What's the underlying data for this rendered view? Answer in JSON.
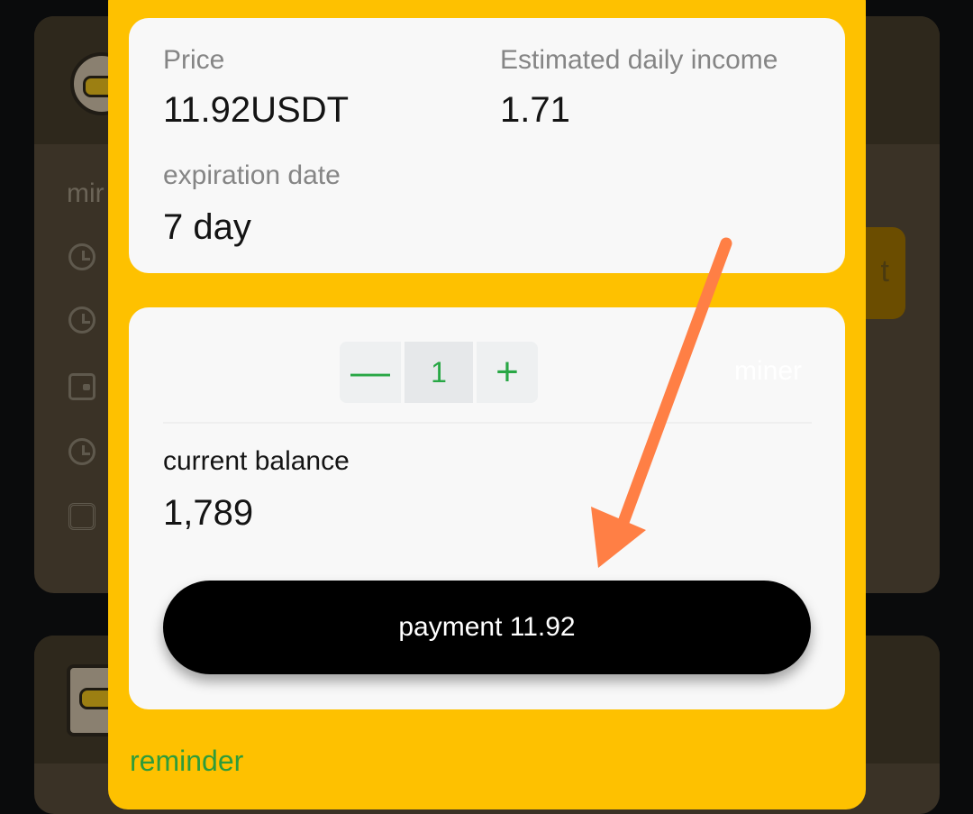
{
  "background": {
    "partial_label": "mir",
    "partial_button": "t"
  },
  "product": {
    "price_label": "Price",
    "price_value": "11.92USDT",
    "income_label": "Estimated daily income",
    "income_value": "1.71",
    "expiration_label": "expiration date",
    "expiration_value": "7 day"
  },
  "purchase": {
    "minus_symbol": "—",
    "quantity": "1",
    "plus_symbol": "+",
    "unit": "miner",
    "balance_label": "current balance",
    "balance_value": "1,789",
    "pay_button_label": "payment 11.92"
  },
  "reminder": "reminder",
  "colors": {
    "modal": "#fec100",
    "card": "#f8f8f8",
    "accent_green": "#28a745",
    "annotation_arrow": "#ff7f45"
  }
}
